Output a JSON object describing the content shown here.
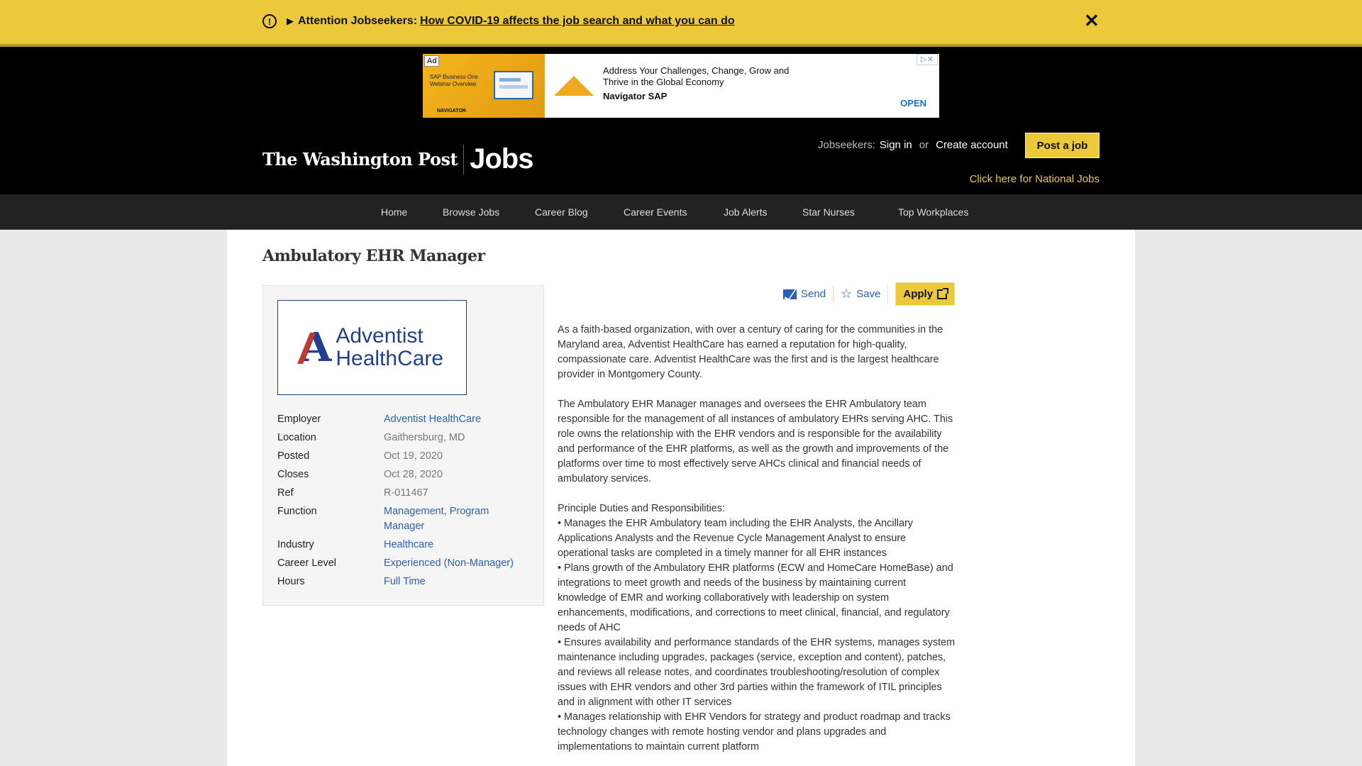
{
  "alert": {
    "prefix": "Attention Jobseekers:",
    "link": "How COVID-19 affects the job search and what you can do",
    "close": "✕"
  },
  "ad": {
    "badge": "Ad",
    "image_title": "SAP Business One Webinar Overview",
    "image_footer": "NAVIGATOR",
    "headline": "Address Your Challenges, Change, Grow and Thrive in the Global Economy",
    "brand": "Navigator SAP",
    "cta": "OPEN"
  },
  "header": {
    "brand": "The Washington Post",
    "jobs": "Jobs",
    "jobseekers_label": "Jobseekers:",
    "sign_in": "Sign in",
    "or": "or",
    "create_account": "Create account",
    "post_job": "Post a job",
    "national": "Click here for National Jobs"
  },
  "nav": [
    "Home",
    "Browse Jobs",
    "Career Blog",
    "Career Events",
    "Job Alerts",
    "Star Nurses",
    "Top Workplaces"
  ],
  "job": {
    "title": "Ambulatory EHR Manager",
    "logo_text_1": "Adventist",
    "logo_text_2": "HealthCare",
    "facts": [
      {
        "k": "Employer",
        "v": "Adventist HealthCare"
      },
      {
        "k": "Location",
        "v": "Gaithersburg, MD"
      },
      {
        "k": "Posted",
        "v": "Oct 19, 2020"
      },
      {
        "k": "Closes",
        "v": "Oct 28, 2020"
      },
      {
        "k": "Ref",
        "v": "R-011467"
      },
      {
        "k": "Function",
        "v": "Management, Program Manager"
      },
      {
        "k": "Industry",
        "v": "Healthcare"
      },
      {
        "k": "Career Level",
        "v": "Experienced (Non-Manager)"
      },
      {
        "k": "Hours",
        "v": "Full Time"
      }
    ],
    "actions": {
      "send": "Send",
      "save": "Save",
      "apply": "Apply"
    },
    "description": {
      "p1": "As a faith-based organization, with over a century of caring for the communities in the Maryland area, Adventist HealthCare has earned a reputation for high-quality, compassionate care. Adventist HealthCare was the first and is the largest healthcare provider in Montgomery County.",
      "p2": "The Ambulatory EHR Manager manages and oversees the EHR Ambulatory team responsible for the management of all instances of ambulatory EHRs serving AHC. This role owns the relationship with the EHR vendors and is responsible for the availability and performance of the EHR platforms, as well as the growth and improvements of the platforms over time to most effectively serve AHCs clinical and financial needs of ambulatory services.",
      "duties_heading": "Principle Duties and Responsibilities:",
      "bullets": [
        "• Manages the EHR Ambulatory team including the EHR Analysts, the Ancillary Applications Analysts and the Revenue Cycle Management Analyst to ensure operational tasks are completed in a timely manner for all EHR instances",
        "• Plans growth of the Ambulatory EHR platforms (ECW and HomeCare HomeBase) and integrations to meet growth and needs of the business by maintaining current knowledge of EMR and working collaboratively with leadership on system enhancements, modifications, and corrections to meet clinical, financial, and regulatory needs of AHC",
        "• Ensures availability and performance standards of the EHR systems, manages system maintenance including upgrades, packages (service, exception and content), patches, and reviews all release notes, and coordinates troubleshooting/resolution of complex issues with EHR vendors and other 3rd parties within the framework of ITIL principles and in alignment with other IT services",
        "• Manages relationship with EHR Vendors for strategy and product roadmap and tracks technology changes with remote hosting vendor and plans upgrades and implementations to maintain current platform"
      ]
    }
  },
  "colors": {
    "accent_yellow": "#ecc93a",
    "link_blue": "#2a5fb4",
    "logo_navy": "#23418a",
    "logo_red": "#c23a2e"
  }
}
